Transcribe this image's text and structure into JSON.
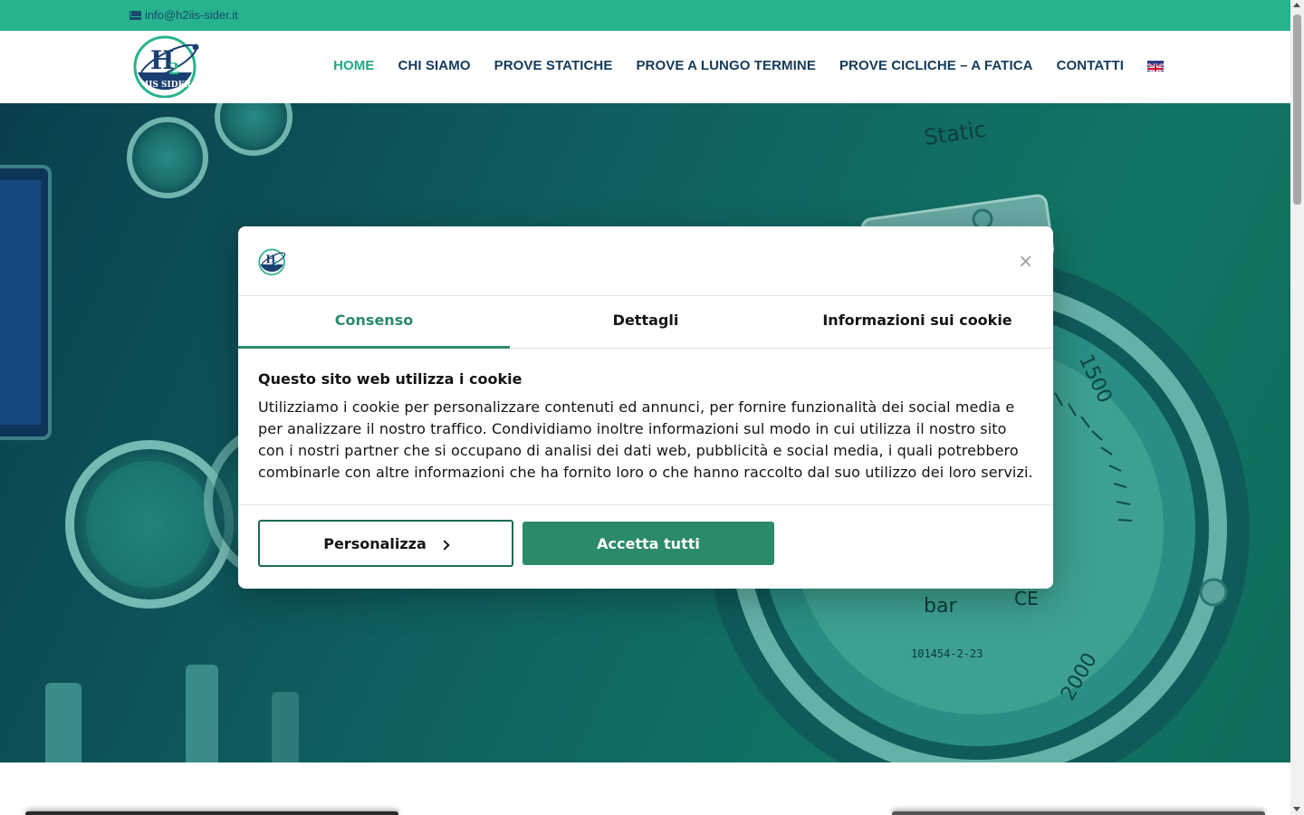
{
  "topbar": {
    "email": "info@h2iis-sider.it"
  },
  "header": {
    "logo_text_top": "H",
    "logo_text_sub": "2",
    "logo_text_bottom": "IIS SIDER",
    "nav": [
      {
        "label": "HOME",
        "active": true
      },
      {
        "label": "CHI SIAMO"
      },
      {
        "label": "PROVE STATICHE"
      },
      {
        "label": "PROVE A LUNGO TERMINE"
      },
      {
        "label": "PROVE CICLICHE – A FATICA"
      },
      {
        "label": "CONTATTI"
      }
    ],
    "language_flag": "uk-flag-icon"
  },
  "hero": {
    "plate_label": "Static",
    "gauge_label_1500": "1500",
    "gauge_label_2000": "2000",
    "gauge_unit": "bar",
    "gauge_serial": "101454-2-23",
    "gauge_ce": "CE"
  },
  "cookie_dialog": {
    "tabs": [
      "Consenso",
      "Dettagli",
      "Informazioni sui cookie"
    ],
    "heading": "Questo sito web utilizza i cookie",
    "body": "Utilizziamo i cookie per personalizzare contenuti ed annunci, per fornire funzionalità dei social media e per analizzare il nostro traffico. Condividiamo inoltre informazioni sul modo in cui utilizza il nostro sito con i nostri partner che si occupano di analisi dei dati web, pubblicità e social media, i quali potrebbero combinarle con altre informazioni che ha fornito loro o che hanno raccolto dal suo utilizzo dei loro servizi.",
    "customize_label": "Personalizza",
    "accept_label": "Accetta tutti",
    "close_label": "×"
  },
  "colors": {
    "brand_green": "#26b38e",
    "accent_green": "#2b8a6b",
    "navy": "#143a5a"
  }
}
